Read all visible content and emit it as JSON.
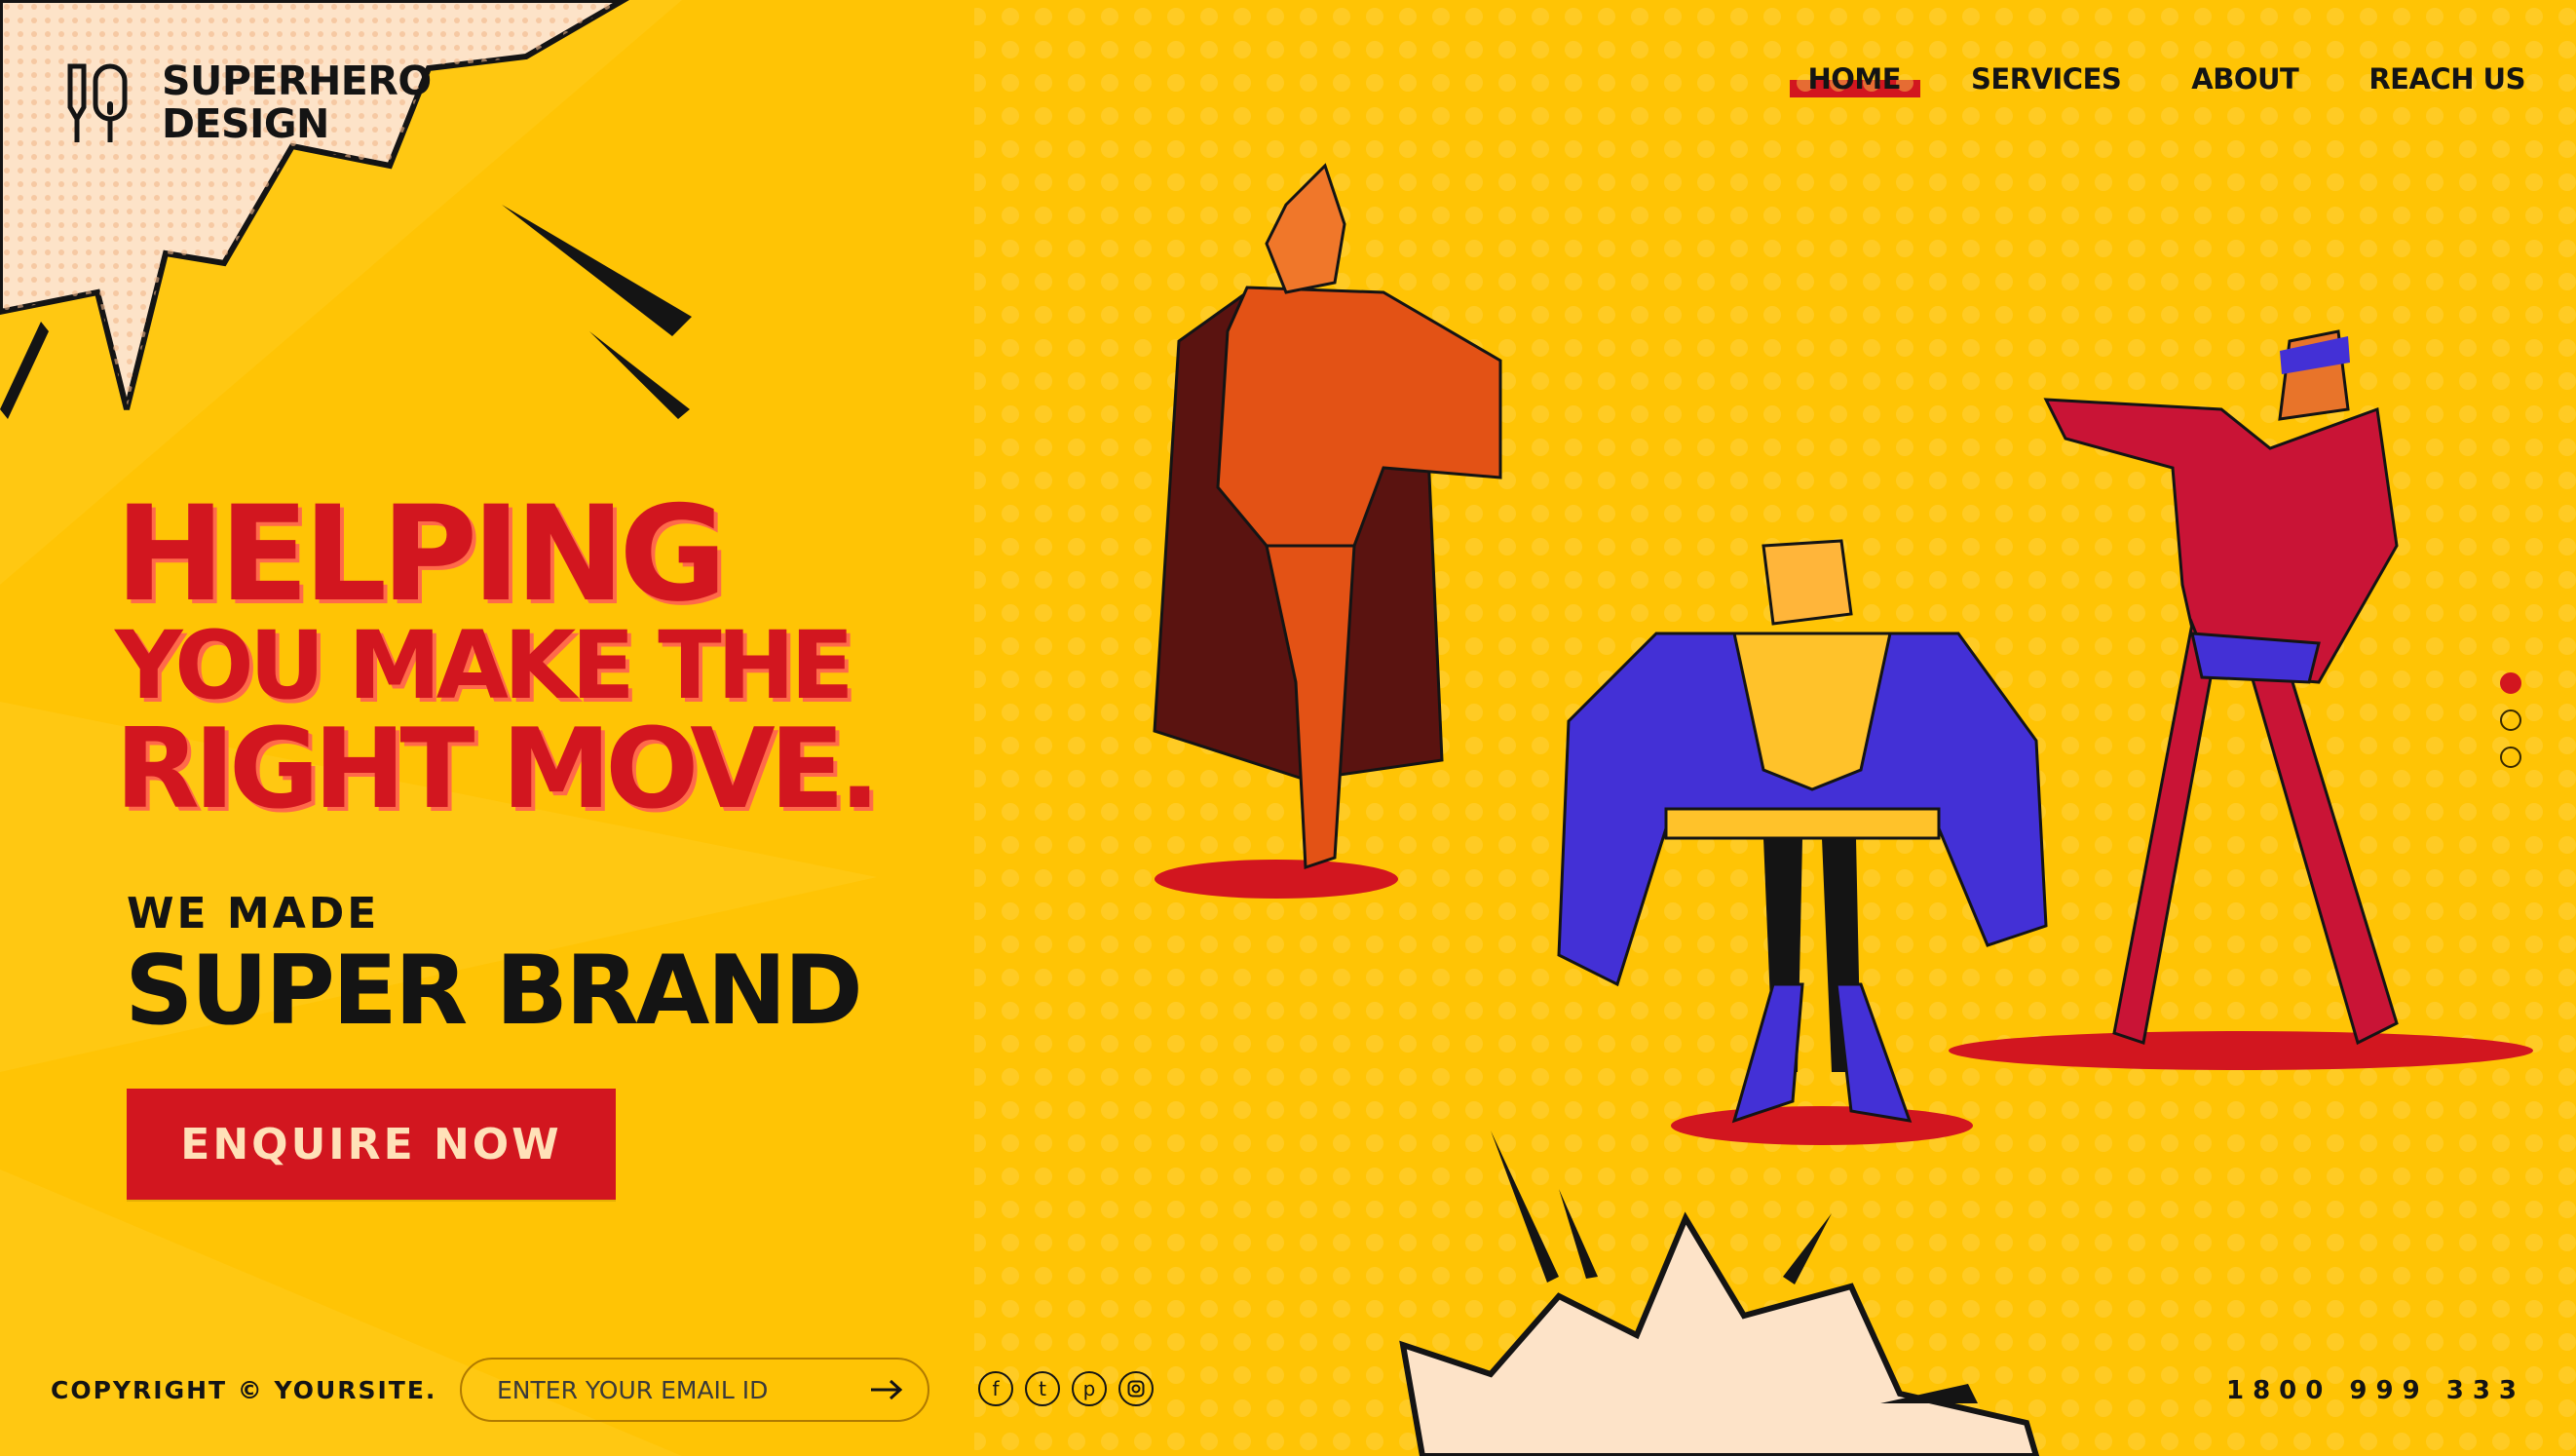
{
  "brand": {
    "line1": "SUPERHERO",
    "line2": "DESIGN",
    "icon": "pen-mouse-icon"
  },
  "nav": {
    "items": [
      {
        "label": "HOME",
        "active": true
      },
      {
        "label": "SERVICES",
        "active": false
      },
      {
        "label": "ABOUT",
        "active": false
      },
      {
        "label": "REACH US",
        "active": false
      }
    ]
  },
  "hero": {
    "line1": "HELPING",
    "line2": "YOU MAKE THE",
    "line3": "RIGHT MOVE.",
    "sub1": "WE MADE",
    "sub2": "SUPER BRAND",
    "cta": "ENQUIRE NOW"
  },
  "slider": {
    "count": 3,
    "active_index": 0
  },
  "footer": {
    "copyright": "COPYRIGHT © YOURSITE.",
    "email_placeholder": "ENTER YOUR EMAIL ID",
    "social": [
      "facebook-icon",
      "twitter-icon",
      "pinterest-icon",
      "instagram-icon"
    ],
    "phone": "1800 999 333"
  },
  "colors": {
    "background": "#ffc405",
    "accent": "#d2161f",
    "text": "#141414"
  }
}
